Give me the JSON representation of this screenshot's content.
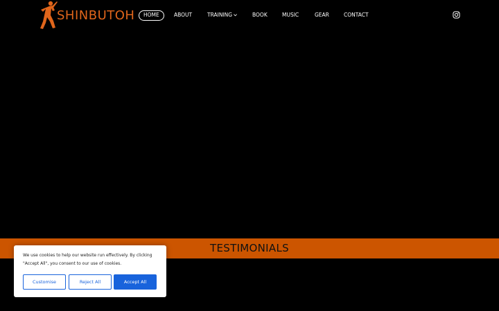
{
  "brand": {
    "name": "SHINBUTOH",
    "color": "#e0651b"
  },
  "nav": {
    "items": [
      {
        "label": "HOME",
        "active": true
      },
      {
        "label": "ABOUT"
      },
      {
        "label": "TRAINING",
        "has_dropdown": true
      },
      {
        "label": "BOOK"
      },
      {
        "label": "MUSIC"
      },
      {
        "label": "GEAR"
      },
      {
        "label": "CONTACT"
      }
    ],
    "social": {
      "icon": "instagram-icon"
    }
  },
  "section": {
    "title": "TESTIMONIALS",
    "band_color": "#cc5500"
  },
  "cookie_banner": {
    "message": "We use cookies to help our website run effectively. By clicking \"Accept All\", you consent to our use of cookies.",
    "customise_label": "Customise",
    "reject_label": "Reject All",
    "accept_label": "Accept All",
    "accent_color": "#1863dc"
  }
}
